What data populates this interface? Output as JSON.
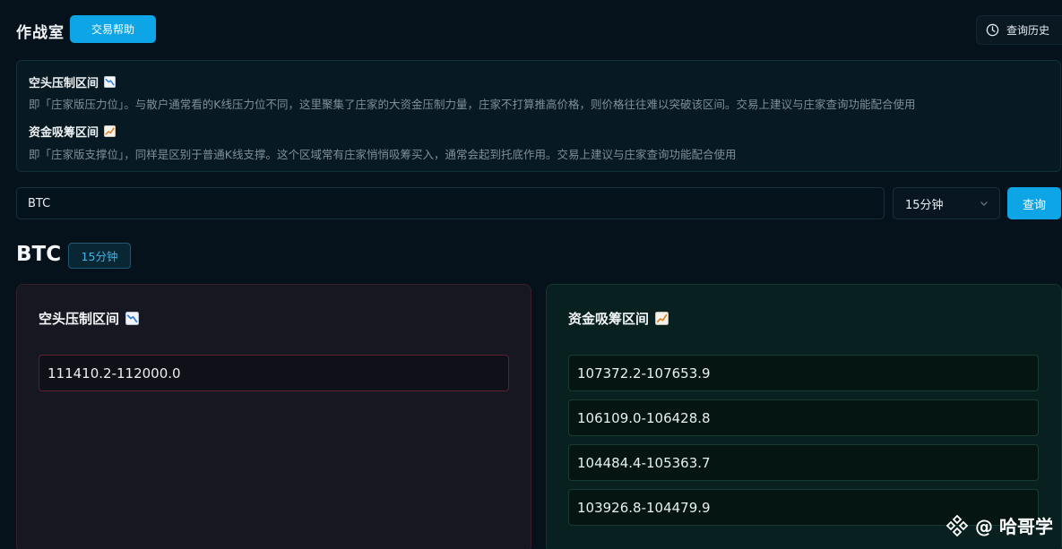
{
  "header": {
    "title": "作战室",
    "help_button": "交易帮助",
    "history_button": "查询历史"
  },
  "info": {
    "resistance_heading": "空头压制区间",
    "resistance_desc": "即「庄家版压力位」。与散户通常看的K线压力位不同，这里聚集了庄家的大资金压制力量，庄家不打算推高价格，则价格往往难以突破该区间。交易上建议与庄家查询功能配合使用",
    "support_heading": "资金吸筹区间",
    "support_desc": "即「庄家版支撑位」，同样是区别于普通K线支撑。这个区域常有庄家悄悄吸筹买入，通常会起到托底作用。交易上建议与庄家查询功能配合使用"
  },
  "search": {
    "symbol_value": "BTC",
    "interval_selected": "15分钟",
    "query_button": "查询"
  },
  "result": {
    "symbol": "BTC",
    "interval_badge": "15分钟",
    "resistance": {
      "title": "空头压制区间",
      "ranges": [
        "111410.2-112000.0"
      ]
    },
    "support": {
      "title": "资金吸筹区间",
      "ranges": [
        "107372.2-107653.9",
        "106109.0-106428.8",
        "104484.4-105363.7",
        "103926.8-104479.9"
      ]
    }
  },
  "watermark": {
    "text": "@ 哈哥学"
  },
  "colors": {
    "accent": "#0ea5e6",
    "background": "#06121b",
    "resistance_border": "#5a2230",
    "support_border": "#173d33"
  }
}
